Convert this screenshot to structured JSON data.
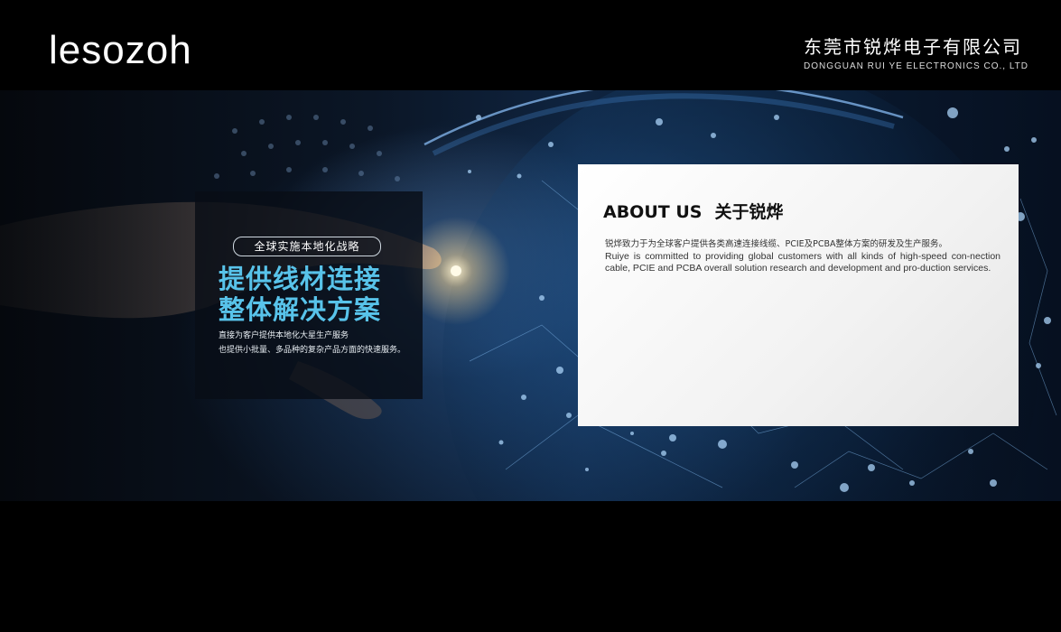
{
  "header": {
    "logo": "lesozoh",
    "company_cn": "东莞市锐烨电子有限公司",
    "company_en": "DONGGUAN RUI YE ELECTRONICS CO., LTD"
  },
  "banner": {
    "tagline": "全球实施本地化战略",
    "headline_line1": "提供线材连接",
    "headline_line2": "整体解决方案",
    "desc_line1": "直接为客户提供本地化大星生产服务",
    "desc_line2": "也提供小批量、多品种的复杂产品方面的快速服务。"
  },
  "about": {
    "title_en": "ABOUT US",
    "title_cn": "关于锐烨",
    "text_cn": "锐烨致力于为全球客户提供各类高速连接线缆、PCIE及PCBA整体方案的研发及生产服务。",
    "text_en": "Ruiye is committed to providing global customers with all kinds of high-speed con-nection cable, PCIE and PCBA overall solution research and development and pro-duction services."
  },
  "colors": {
    "headline": "#58c3ea",
    "background": "#000000",
    "about_bg": "#ffffff"
  }
}
